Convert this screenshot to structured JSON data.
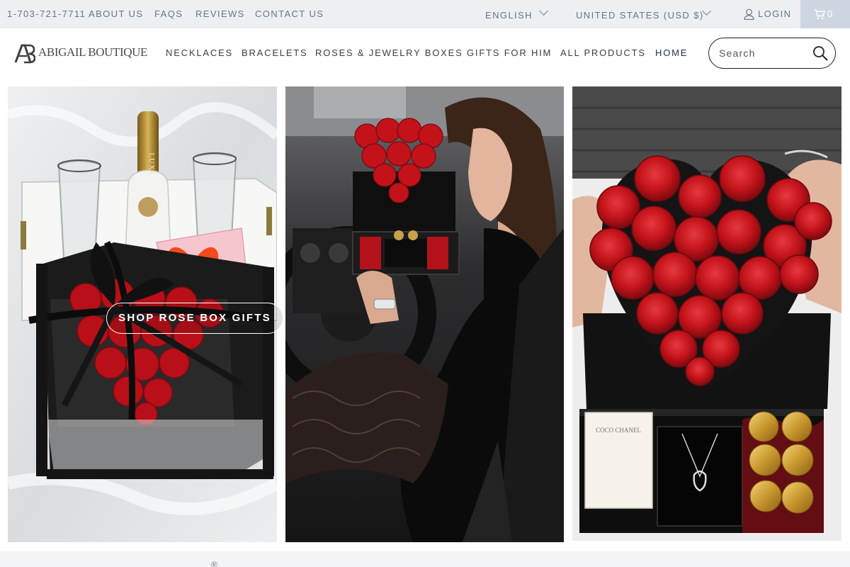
{
  "topbar": {
    "phone": "1-703-721-7711",
    "links": [
      "ABOUT US",
      "FAQS",
      "REVIEWS",
      "CONTACT US"
    ],
    "language": "ENGLISH",
    "currency": "UNITED STATES (USD $)",
    "login": "LOGIN",
    "cart_count": "0"
  },
  "header": {
    "logo_text": "ABIGAIL BOUTIQUE",
    "nav": [
      "NECKLACES",
      "BRACELETS",
      "ROSES & JEWELRY BOXES",
      "GIFTS FOR HIM",
      "ALL PRODUCTS",
      "HOME"
    ],
    "search_placeholder": "Search"
  },
  "hero": {
    "cta_label": "SHOP ROSE BOX GIFTS",
    "tiles": [
      {
        "name": "rose-box-champagne-photo",
        "brand_text": "LUXE"
      },
      {
        "name": "woman-in-car-rose-box-photo"
      },
      {
        "name": "heart-rose-box-jewelry-drawer-photo",
        "brand_text": "COCO CHANEL"
      }
    ]
  },
  "footer": {
    "registered_mark": "®"
  },
  "colors": {
    "topbar_bg": "#edf0f3",
    "cart_bg": "#cdd6e0",
    "nav_active": "#1f2e52",
    "rose_red": "#c4121a",
    "box_black": "#141414"
  }
}
